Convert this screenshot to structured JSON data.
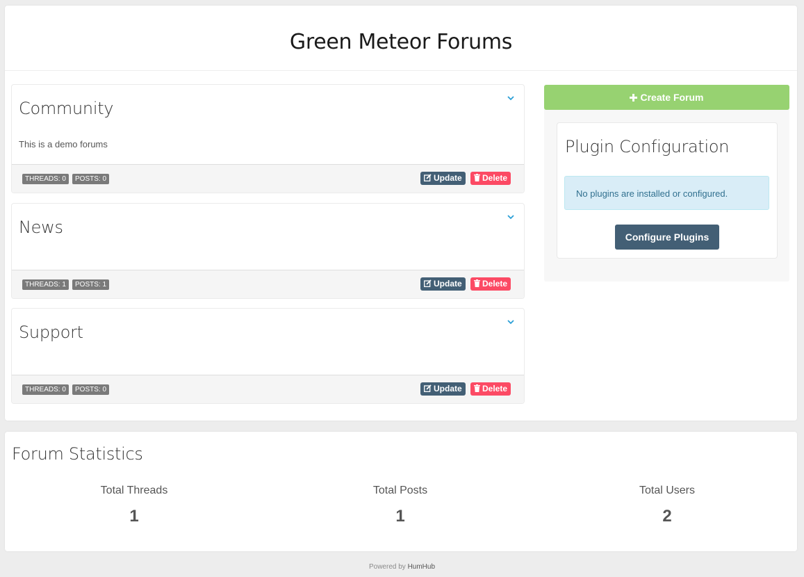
{
  "header": {
    "title": "Green Meteor Forums"
  },
  "forums": [
    {
      "name": "Community",
      "description": "This is a demo forums",
      "threads_badge": "THREADS: 0",
      "posts_badge": "POSTS: 0",
      "update_label": "Update",
      "delete_label": "Delete"
    },
    {
      "name": "News",
      "description": "",
      "threads_badge": "THREADS: 1",
      "posts_badge": "POSTS: 1",
      "update_label": "Update",
      "delete_label": "Delete"
    },
    {
      "name": "Support",
      "description": "",
      "threads_badge": "THREADS: 0",
      "posts_badge": "POSTS: 0",
      "update_label": "Update",
      "delete_label": "Delete"
    }
  ],
  "sidebar": {
    "create_button": "Create Forum",
    "plugin_title": "Plugin Configuration",
    "plugin_alert": "No plugins are installed or configured.",
    "configure_button": "Configure Plugins"
  },
  "stats": {
    "title": "Forum Statistics",
    "items": [
      {
        "label": "Total Threads",
        "value": "1"
      },
      {
        "label": "Total Posts",
        "value": "1"
      },
      {
        "label": "Total Users",
        "value": "2"
      }
    ]
  },
  "footer": {
    "powered_by": "Powered by",
    "brand": "HumHub"
  },
  "colors": {
    "accent_green": "#97d271",
    "primary": "#435f75",
    "danger": "#fc4a64",
    "info_bg": "#d9edf7"
  },
  "icons": {
    "chevron": "chevron-down-icon",
    "edit": "edit-icon",
    "trash": "trash-icon",
    "plus": "plus-icon"
  }
}
